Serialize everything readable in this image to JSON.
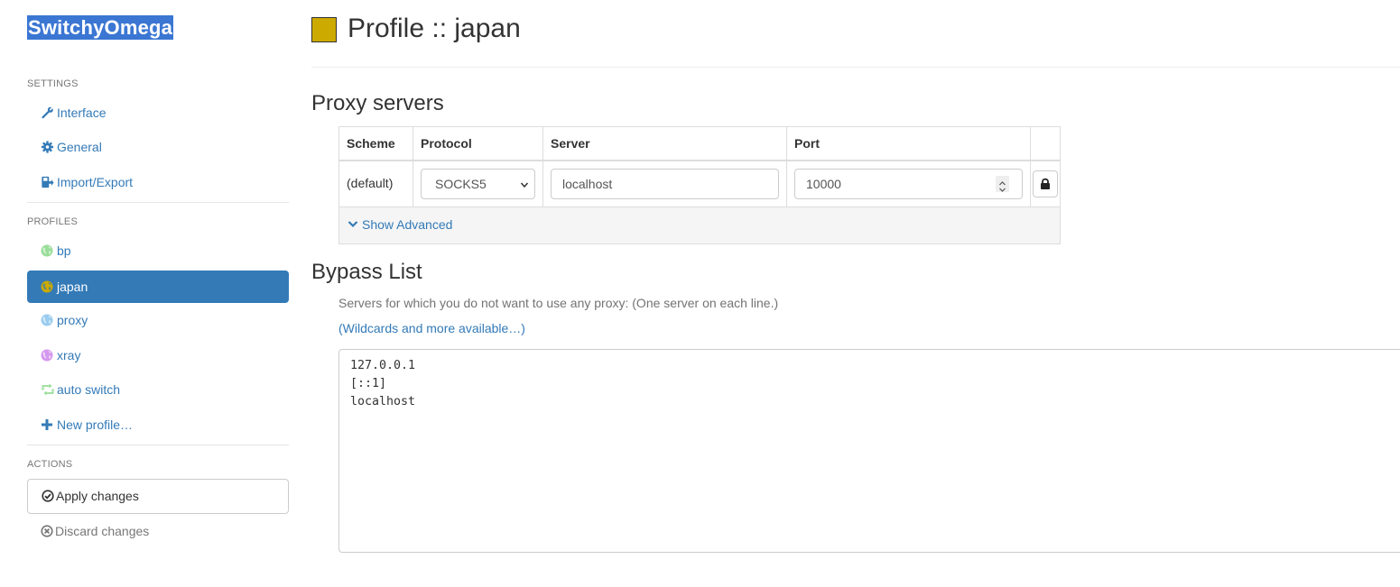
{
  "sidebar": {
    "brand": "SwitchyOmega",
    "settings_header": "SETTINGS",
    "settings_items": [
      {
        "label": "Interface",
        "icon": "wrench-icon"
      },
      {
        "label": "General",
        "icon": "gear-icon"
      },
      {
        "label": "Import/Export",
        "icon": "import-export-icon"
      }
    ],
    "profiles_header": "PROFILES",
    "profiles": [
      {
        "label": "bp",
        "icon": "globe-icon",
        "color": "#99dd99"
      },
      {
        "label": "japan",
        "icon": "globe-icon",
        "color": "#ccaa00",
        "active": true
      },
      {
        "label": "proxy",
        "icon": "globe-icon",
        "color": "#99ccee"
      },
      {
        "label": "xray",
        "icon": "globe-icon",
        "color": "#d497ee"
      },
      {
        "label": "auto switch",
        "icon": "retweet-icon",
        "color": "#99dd99"
      }
    ],
    "new_profile": "New profile…",
    "actions_header": "ACTIONS",
    "apply": "Apply changes",
    "discard": "Discard changes"
  },
  "main": {
    "title": "Profile :: japan",
    "profile_color": "#ccaa00",
    "proxy_heading": "Proxy servers",
    "table": {
      "headers": [
        "Scheme",
        "Protocol",
        "Server",
        "Port"
      ],
      "row": {
        "scheme": "(default)",
        "protocol": "SOCKS5",
        "server": "localhost",
        "port": "10000"
      },
      "show_advanced": "Show Advanced"
    },
    "bypass_heading": "Bypass List",
    "bypass_help": "Servers for which you do not want to use any proxy: (One server on each line.)",
    "wildcards_link": "(Wildcards and more available…)",
    "bypass_lines": [
      "127.0.0.1",
      "[::1]",
      "localhost"
    ]
  }
}
